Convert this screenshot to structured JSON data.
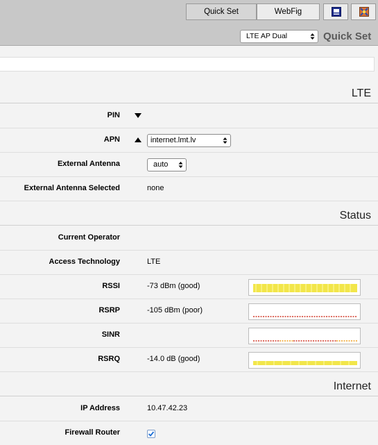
{
  "toolbar": {
    "quick_set_label": "Quick Set",
    "webfig_label": "WebFig",
    "icon1": "terminal-icon",
    "icon2": "winbox-icon"
  },
  "header": {
    "mode_value": "LTE AP Dual",
    "title": "Quick Set"
  },
  "sections": {
    "lte": "LTE",
    "status": "Status",
    "internet": "Internet"
  },
  "lte": {
    "pin_label": "PIN",
    "apn_label": "APN",
    "apn_value": "internet.lmt.lv",
    "external_antenna_label": "External Antenna",
    "external_antenna_value": "auto",
    "external_antenna_selected_label": "External Antenna Selected",
    "external_antenna_selected_value": "none"
  },
  "status": {
    "current_operator_label": "Current Operator",
    "current_operator_value": "",
    "access_technology_label": "Access Technology",
    "access_technology_value": "LTE",
    "rssi_label": "RSSI",
    "rssi_value": "-73 dBm (good)",
    "rsrp_label": "RSRP",
    "rsrp_value": "-105 dBm (poor)",
    "sinr_label": "SINR",
    "sinr_value": "",
    "rsrq_label": "RSRQ",
    "rsrq_value": "-14.0 dB (good)"
  },
  "internet": {
    "ip_address_label": "IP Address",
    "ip_address_value": "10.47.42.23",
    "firewall_router_label": "Firewall Router",
    "firewall_router_checked": true
  },
  "colors": {
    "good": "#f2e64a",
    "poor": "#d23a2a",
    "fair": "#f0a020",
    "check": "#1d6fd6"
  }
}
